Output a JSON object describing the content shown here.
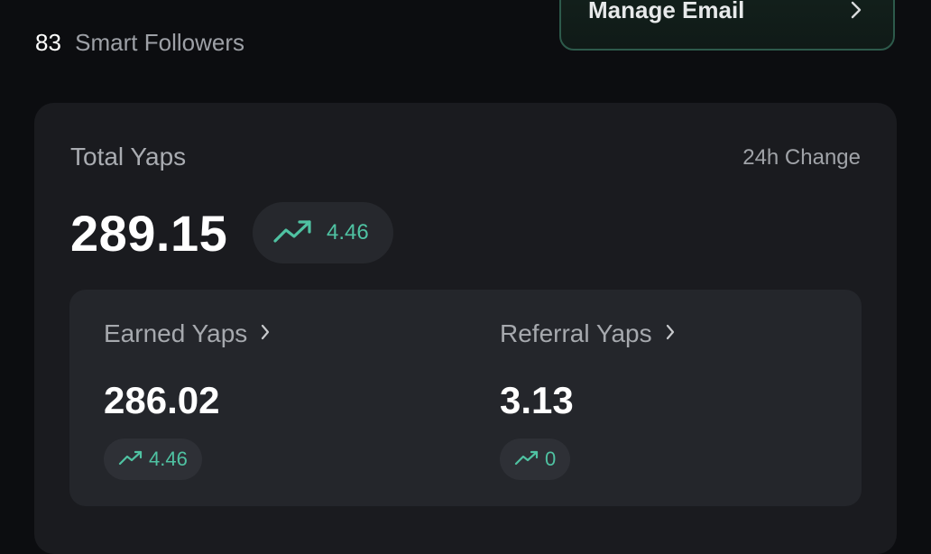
{
  "followers": {
    "count": "83",
    "label": "Smart Followers"
  },
  "manage_email": {
    "label": "Manage Email"
  },
  "total": {
    "label": "Total Yaps",
    "change_label": "24h Change",
    "value": "289.15",
    "change": "4.46"
  },
  "earned": {
    "label": "Earned Yaps",
    "value": "286.02",
    "change": "4.46"
  },
  "referral": {
    "label": "Referral Yaps",
    "value": "3.13",
    "change": "0"
  },
  "colors": {
    "accent": "#4fc2a2",
    "background": "#0c0d10",
    "card": "#1a1b1f",
    "sub_card": "#24262b"
  },
  "icons": {
    "trend": "trending-up-icon",
    "chevron": "chevron-right-icon"
  }
}
